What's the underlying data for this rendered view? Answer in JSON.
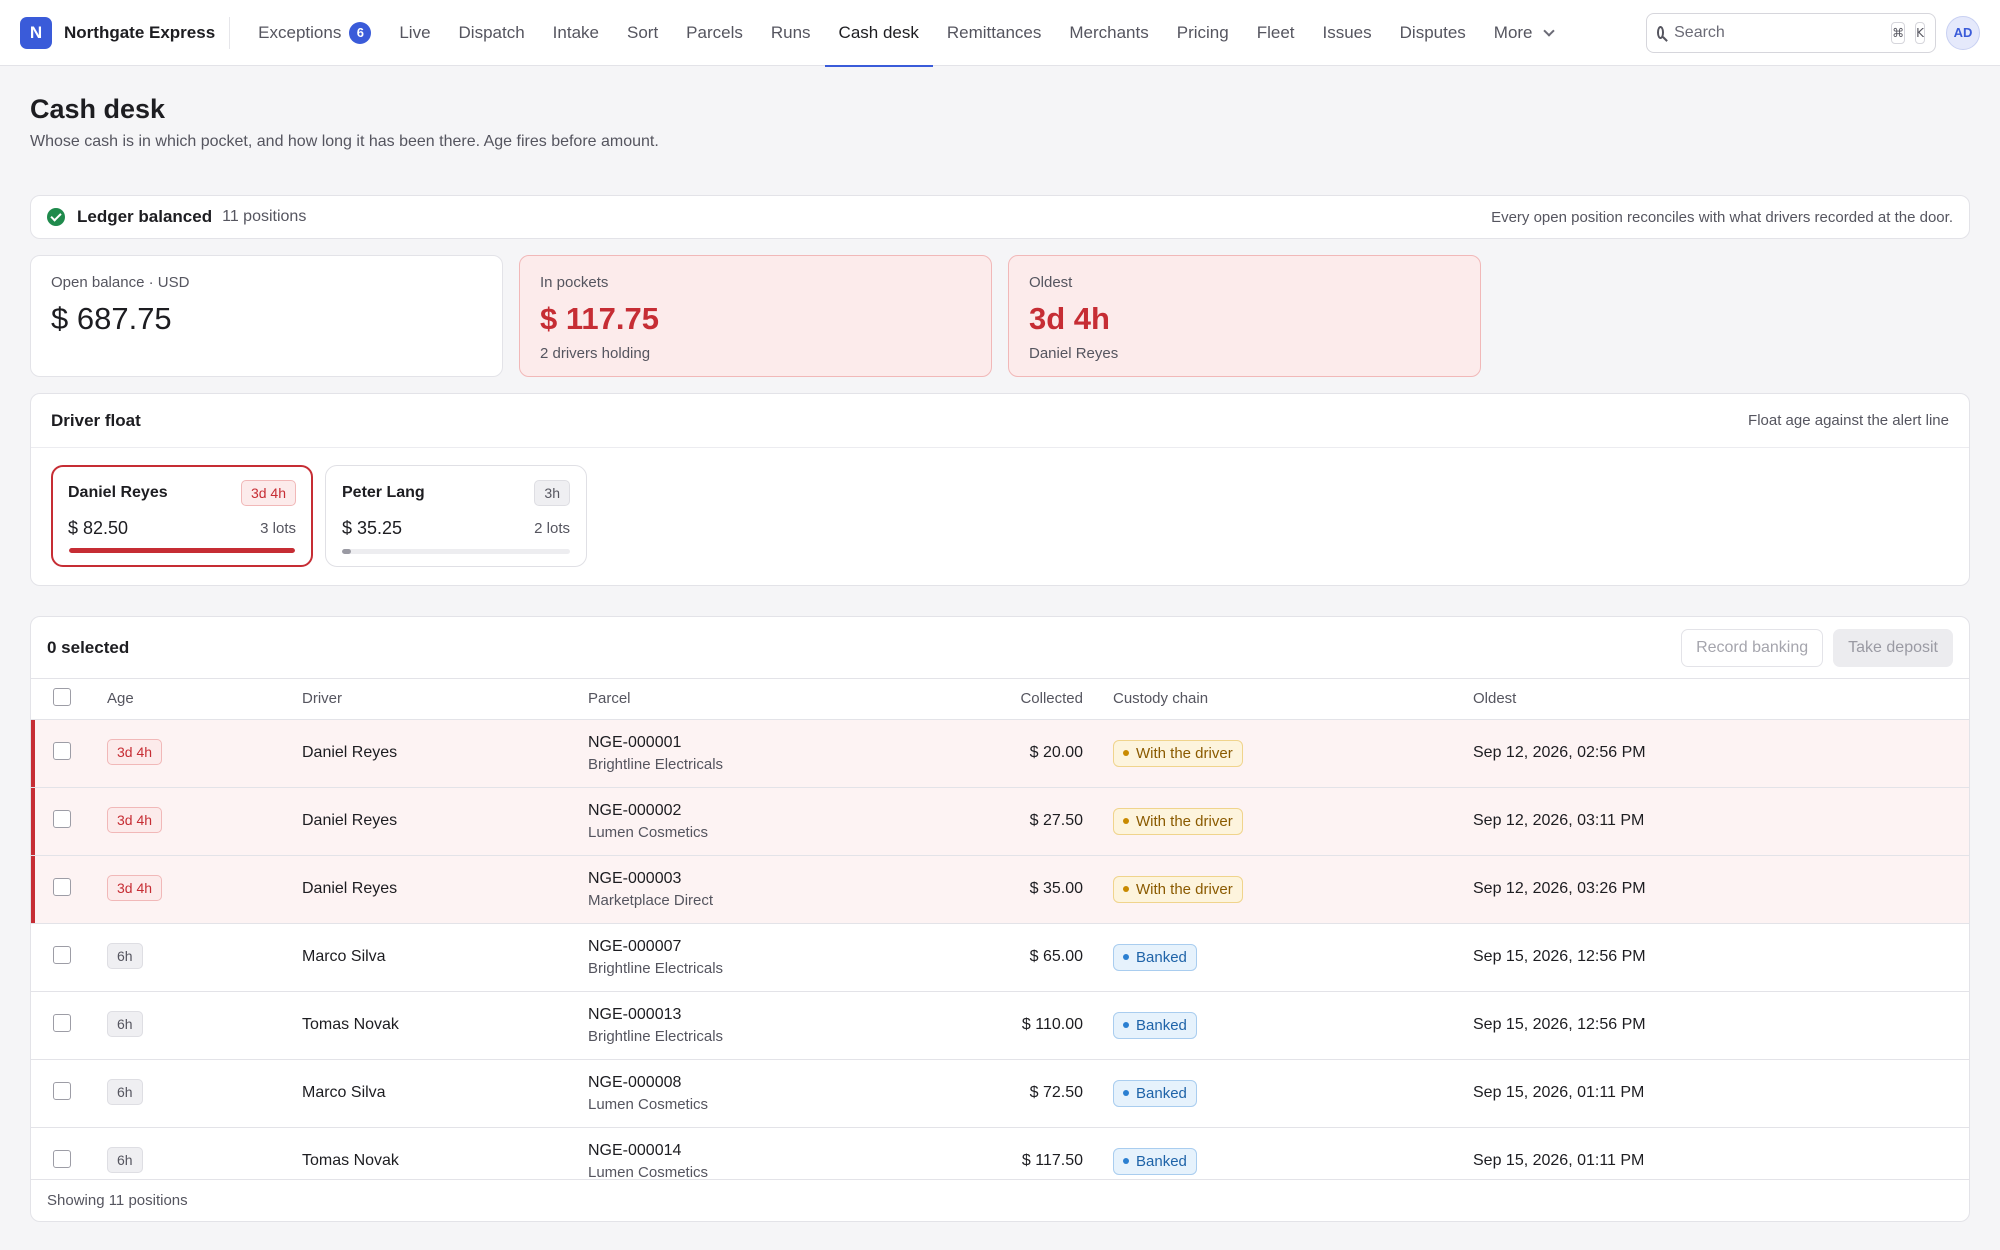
{
  "brand": {
    "logo_letter": "N",
    "name": "Northgate Express"
  },
  "nav": {
    "items": [
      {
        "label": "Exceptions",
        "badge": "6"
      },
      {
        "label": "Live"
      },
      {
        "label": "Dispatch"
      },
      {
        "label": "Intake"
      },
      {
        "label": "Sort"
      },
      {
        "label": "Parcels"
      },
      {
        "label": "Runs"
      },
      {
        "label": "Cash desk",
        "active": true
      },
      {
        "label": "Remittances"
      },
      {
        "label": "Merchants"
      },
      {
        "label": "Pricing"
      },
      {
        "label": "Fleet"
      },
      {
        "label": "Issues"
      },
      {
        "label": "Disputes"
      }
    ],
    "more_label": "More"
  },
  "search": {
    "placeholder": "Search",
    "shortcut_mod": "⌘",
    "shortcut_key": "K"
  },
  "user": {
    "initials": "AD"
  },
  "page": {
    "title": "Cash desk",
    "subtitle": "Whose cash is in which pocket, and how long it has been there. Age fires before amount."
  },
  "ledger": {
    "title": "Ledger balanced",
    "count": "11 positions",
    "note": "Every open position reconciles with what drivers recorded at the door."
  },
  "stats": [
    {
      "label": "Open balance · USD",
      "value": "$ 687.75",
      "sub": "",
      "alert": false
    },
    {
      "label": "In pockets",
      "value": "$ 117.75",
      "sub": "2 drivers holding",
      "alert": true
    },
    {
      "label": "Oldest",
      "value": "3d 4h",
      "sub": "Daniel Reyes",
      "alert": true
    }
  ],
  "driver_float": {
    "title": "Driver float",
    "note": "Float age against the alert line",
    "drivers": [
      {
        "name": "Daniel Reyes",
        "age": "3d 4h",
        "amount": "$ 82.50",
        "lots": "3 lots",
        "alert": true,
        "level": 1.0
      },
      {
        "name": "Peter Lang",
        "age": "3h",
        "amount": "$ 35.25",
        "lots": "2 lots",
        "alert": false,
        "level": 0.04
      }
    ]
  },
  "table": {
    "selected_label": "0 selected",
    "record_banking_label": "Record banking",
    "take_deposit_label": "Take deposit",
    "headers": {
      "age": "Age",
      "driver": "Driver",
      "parcel": "Parcel",
      "collected": "Collected",
      "custody": "Custody chain",
      "oldest": "Oldest"
    },
    "rows": [
      {
        "age": "3d 4h",
        "driver": "Daniel Reyes",
        "parcel_id": "NGE-000001",
        "merchant": "Brightline Electricals",
        "collected": "$ 20.00",
        "custody": "With the driver",
        "oldest": "Sep 12, 2026, 02:56 PM",
        "aging": true
      },
      {
        "age": "3d 4h",
        "driver": "Daniel Reyes",
        "parcel_id": "NGE-000002",
        "merchant": "Lumen Cosmetics",
        "collected": "$ 27.50",
        "custody": "With the driver",
        "oldest": "Sep 12, 2026, 03:11 PM",
        "aging": true
      },
      {
        "age": "3d 4h",
        "driver": "Daniel Reyes",
        "parcel_id": "NGE-000003",
        "merchant": "Marketplace Direct",
        "collected": "$ 35.00",
        "custody": "With the driver",
        "oldest": "Sep 12, 2026, 03:26 PM",
        "aging": true
      },
      {
        "age": "6h",
        "driver": "Marco Silva",
        "parcel_id": "NGE-000007",
        "merchant": "Brightline Electricals",
        "collected": "$ 65.00",
        "custody": "Banked",
        "oldest": "Sep 15, 2026, 12:56 PM",
        "aging": false
      },
      {
        "age": "6h",
        "driver": "Tomas Novak",
        "parcel_id": "NGE-000013",
        "merchant": "Brightline Electricals",
        "collected": "$ 110.00",
        "custody": "Banked",
        "oldest": "Sep 15, 2026, 12:56 PM",
        "aging": false
      },
      {
        "age": "6h",
        "driver": "Marco Silva",
        "parcel_id": "NGE-000008",
        "merchant": "Lumen Cosmetics",
        "collected": "$ 72.50",
        "custody": "Banked",
        "oldest": "Sep 15, 2026, 01:11 PM",
        "aging": false
      },
      {
        "age": "6h",
        "driver": "Tomas Novak",
        "parcel_id": "NGE-000014",
        "merchant": "Lumen Cosmetics",
        "collected": "$ 117.50",
        "custody": "Banked",
        "oldest": "Sep 15, 2026, 01:11 PM",
        "aging": false
      }
    ],
    "footer": "Showing 11 positions"
  },
  "colors": {
    "accent": "#3a5bd9",
    "alert": "#c62d34",
    "success": "#1f8a4c",
    "banked": "#2b7fd1",
    "with_driver": "#c98a00"
  }
}
